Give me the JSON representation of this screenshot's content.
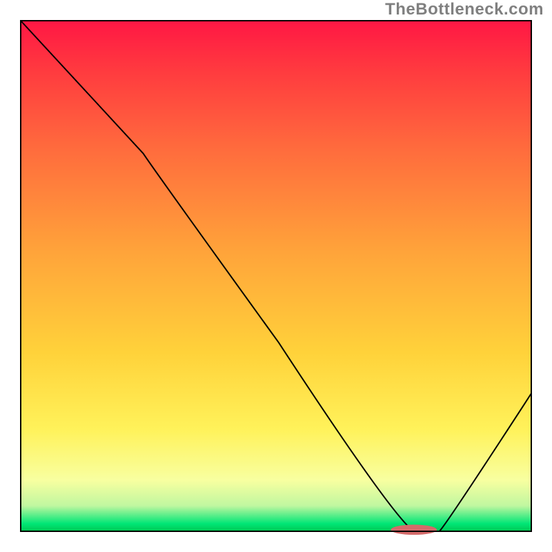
{
  "watermark": "TheBottleneck.com",
  "chart_data": {
    "type": "line",
    "title": "",
    "xlabel": "",
    "ylabel": "",
    "xlim": [
      0,
      100
    ],
    "ylim": [
      0,
      100
    ],
    "x": [
      0,
      24,
      77,
      82,
      100
    ],
    "values": [
      100,
      74,
      0,
      0,
      27
    ],
    "marker": {
      "cx": 77,
      "cy": 0.3,
      "rx": 4.5,
      "ry": 1.0,
      "color": "#d46a6a"
    },
    "gradient_stops": [
      {
        "offset": 0.0,
        "color": "#ff1744"
      },
      {
        "offset": 0.1,
        "color": "#ff3b3f"
      },
      {
        "offset": 0.25,
        "color": "#ff6b3d"
      },
      {
        "offset": 0.45,
        "color": "#ffa33a"
      },
      {
        "offset": 0.65,
        "color": "#ffd23a"
      },
      {
        "offset": 0.8,
        "color": "#fff25a"
      },
      {
        "offset": 0.9,
        "color": "#f8ffa0"
      },
      {
        "offset": 0.95,
        "color": "#c0f7a0"
      },
      {
        "offset": 0.985,
        "color": "#00e676"
      },
      {
        "offset": 1.0,
        "color": "#00c853"
      }
    ],
    "frame": {
      "stroke": "#000000",
      "width": 2
    },
    "line_style": {
      "stroke": "#000000",
      "width": 2
    }
  },
  "plot_geom": {
    "outer_w": 800,
    "outer_h": 800,
    "inner_x": 30,
    "inner_y": 30,
    "inner_w": 740,
    "inner_h": 740
  }
}
